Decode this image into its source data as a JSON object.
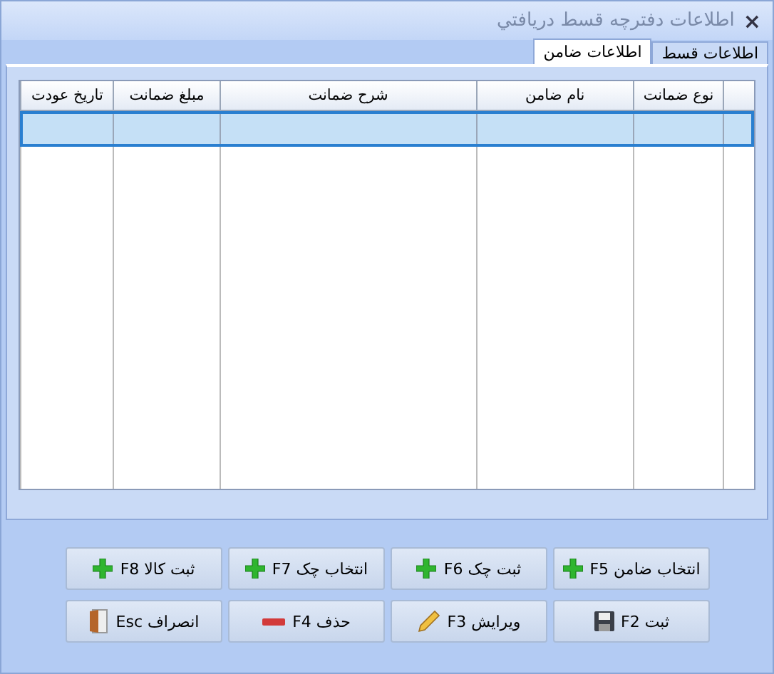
{
  "window": {
    "title": "اطلاعات دفترچه قسط دريافتي",
    "close": "×"
  },
  "tabs": [
    {
      "label": "اطلاعات قسط",
      "selected": false
    },
    {
      "label": "اطلاعات ضامن",
      "selected": true
    }
  ],
  "table": {
    "columns": [
      "نوع ضمانت",
      "نام ضامن",
      "شرح ضمانت",
      "مبلغ ضمانت",
      "تاریخ عودت"
    ],
    "rows": [
      {
        "selected": true
      }
    ]
  },
  "buttons": [
    {
      "label": "انتخاب ضامن F5",
      "kind": "add"
    },
    {
      "label": "ثبت چک F6",
      "kind": "add"
    },
    {
      "label": "انتخاب چک F7",
      "kind": "add"
    },
    {
      "label": "ثبت کالا F8",
      "kind": "add"
    },
    {
      "label": "ثبت F2",
      "kind": "save"
    },
    {
      "label": "ویرایش F3",
      "kind": "edit"
    },
    {
      "label": "حذف F4",
      "kind": "delete"
    },
    {
      "label": "انصراف Esc",
      "kind": "exit"
    }
  ]
}
